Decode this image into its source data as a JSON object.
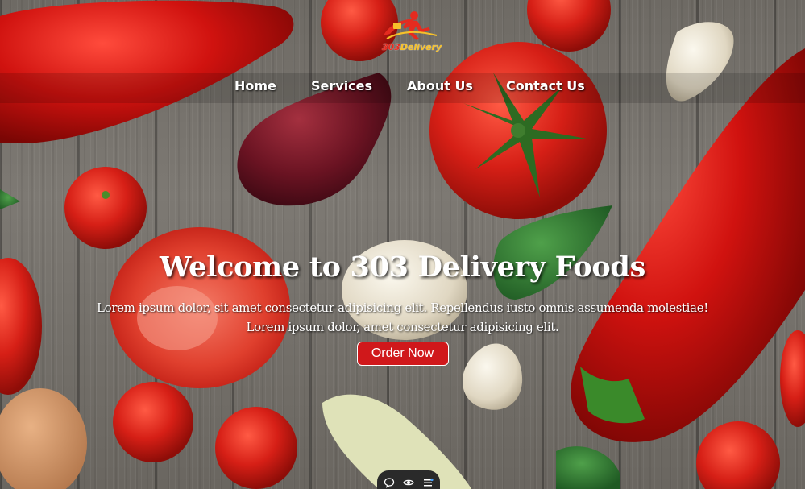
{
  "brand": {
    "logo_text_main": "303",
    "logo_text_accent": "Delivery"
  },
  "nav": {
    "items": [
      {
        "label": "Home"
      },
      {
        "label": "Services"
      },
      {
        "label": "About Us"
      },
      {
        "label": "Contact Us"
      }
    ]
  },
  "hero": {
    "title": "Welcome to 303 Delivery Foods",
    "subtitle_line1": "Lorem ipsum dolor, sit amet consectetur adipisicing elit. Repellendus iusto omnis assumenda molestiae!",
    "subtitle_line2": "Lorem ipsum dolor, amet consectetur adipisicing elit.",
    "cta_label": "Order Now"
  },
  "colors": {
    "cta_background": "#d0181b",
    "logo_red": "#e52b1f",
    "logo_yellow": "#f6c12a",
    "nav_text": "#ffffff"
  },
  "bottom_toolbar": {
    "icons": [
      "chat-bubble-icon",
      "eye-icon",
      "list-icon"
    ]
  }
}
